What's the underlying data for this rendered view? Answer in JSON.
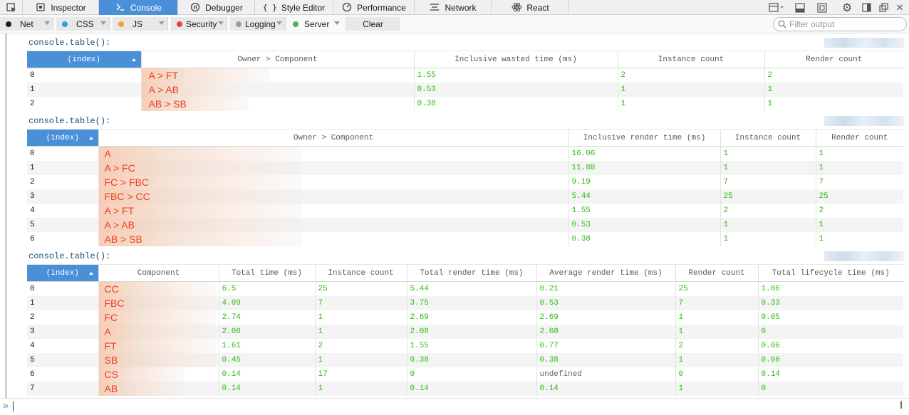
{
  "toolbar": {
    "tabs": [
      {
        "label": "Inspector",
        "icon": "inspector-icon"
      },
      {
        "label": "Console",
        "icon": "console-icon",
        "selected": true
      },
      {
        "label": "Debugger",
        "icon": "debugger-icon"
      },
      {
        "label": "Style Editor",
        "icon": "style-editor-icon"
      },
      {
        "label": "Performance",
        "icon": "performance-icon"
      },
      {
        "label": "Network",
        "icon": "network-icon"
      },
      {
        "label": "React",
        "icon": "react-icon"
      }
    ],
    "accent": "#4a90d9"
  },
  "filters": {
    "buttons": [
      {
        "label": "Net",
        "color": "#1f1f1f"
      },
      {
        "label": "CSS",
        "color": "#2aa3e0"
      },
      {
        "label": "JS",
        "color": "#f0a330"
      },
      {
        "label": "Security",
        "color": "#e8403c"
      },
      {
        "label": "Logging",
        "color": "#9a9a9a"
      },
      {
        "label": "Server",
        "color": "#4db05e"
      }
    ],
    "clear_label": "Clear",
    "filter_placeholder": "Filter output"
  },
  "console": {
    "messages": [
      {
        "text": "console.table():",
        "headers": [
          "(index)",
          "Owner > Component",
          "Inclusive wasted time (ms)",
          "Instance count",
          "Render count"
        ],
        "rows": [
          [
            "0",
            "A > FT",
            "1.55",
            "2",
            "2"
          ],
          [
            "1",
            "A > AB",
            "0.53",
            "1",
            "1"
          ],
          [
            "2",
            "AB > SB",
            "0.38",
            "1",
            "1"
          ]
        ]
      },
      {
        "text": "console.table():",
        "headers": [
          "(index)",
          "Owner > Component",
          "Inclusive render time (ms)",
          "Instance count",
          "Render count"
        ],
        "rows": [
          [
            "0",
            "A",
            "16.06",
            "1",
            "1"
          ],
          [
            "1",
            "A > FC",
            "11.88",
            "1",
            "1"
          ],
          [
            "2",
            "FC > FBC",
            "9.19",
            "7",
            "7"
          ],
          [
            "3",
            "FBC > CC",
            "5.44",
            "25",
            "25"
          ],
          [
            "4",
            "A > FT",
            "1.55",
            "2",
            "2"
          ],
          [
            "5",
            "A > AB",
            "0.53",
            "1",
            "1"
          ],
          [
            "6",
            "AB > SB",
            "0.38",
            "1",
            "1"
          ]
        ]
      },
      {
        "text": "console.table():",
        "headers": [
          "(index)",
          "Component",
          "Total time (ms)",
          "Instance count",
          "Total render time (ms)",
          "Average render time (ms)",
          "Render count",
          "Total lifecycle time (ms)"
        ],
        "rows": [
          [
            "0",
            "CC",
            "6.5",
            "25",
            "5.44",
            "0.21",
            "25",
            "1.06"
          ],
          [
            "1",
            "FBC",
            "4.09",
            "7",
            "3.75",
            "0.53",
            "7",
            "0.33"
          ],
          [
            "2",
            "FC",
            "2.74",
            "1",
            "2.69",
            "2.69",
            "1",
            "0.05"
          ],
          [
            "3",
            "A",
            "2.08",
            "1",
            "2.08",
            "2.08",
            "1",
            "0"
          ],
          [
            "4",
            "FT",
            "1.61",
            "2",
            "1.55",
            "0.77",
            "2",
            "0.06"
          ],
          [
            "5",
            "SB",
            "0.45",
            "1",
            "0.38",
            "0.38",
            "1",
            "0.06"
          ],
          [
            "6",
            "CS",
            "0.14",
            "17",
            "0",
            "undefined",
            "0",
            "0.14"
          ],
          [
            "7",
            "AB",
            "0.14",
            "1",
            "0.14",
            "0.14",
            "1",
            "0"
          ]
        ]
      }
    ]
  },
  "input": {
    "prompt": "»",
    "value": ""
  },
  "colors": {
    "number": "#2cbb0f",
    "component": "#ef4022",
    "message": "#1d4f73"
  }
}
